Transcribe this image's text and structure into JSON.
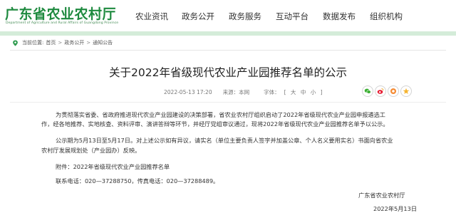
{
  "site": {
    "title": "广东省农业农村厅",
    "subtitle": "Department of Agriculture and Rural Affairs of Guangdong Province"
  },
  "nav": {
    "items": [
      {
        "label": "农业资讯"
      },
      {
        "label": "政务公开"
      },
      {
        "label": "政务服务"
      },
      {
        "label": "互动平台"
      },
      {
        "label": "数据发布"
      },
      {
        "label": "组织机构"
      }
    ]
  },
  "breadcrumb": {
    "prefix": "当前位置:",
    "items": [
      "首页",
      "政务公开",
      "通知公告"
    ],
    "separator": ">"
  },
  "article": {
    "title": "关于2022年省级现代农业产业园推荐名单的公示",
    "datetime": "2022-05-13 17:20",
    "source_label": "来源：本网",
    "fontsize_label": "字体：",
    "fontsize_open": "[",
    "fontsize_options": [
      "大",
      "中",
      "小"
    ],
    "fontsize_close": "]",
    "p1_line1": "为贯彻落实省委、省政府推进现代农业产业园建设的决策部署，省农业农村厅组织启动了2022年省级现代农业产业园申报遴选工",
    "p1_line2": "作，经各地推荐、实地核查、资料评审、演讲答辩等环节，并经厅党组审议通过，现将2022年省级现代农业产业园推荐名单予以公示。",
    "p2_line1": "公示期为5月13日至5月17日。对上述公示如有异议，请实名（单位主要负责人签字并加盖公章、个人名义要用实名）书面向省农业",
    "p2_line2": "农村厅发展规划处（产业园办）反映。",
    "attachment": "附件：2022年省级现代农业产业园推荐名单",
    "contact": "联系电话：020—37288750，传真电话：020—37288489。",
    "signature": "广东省农业农村厅",
    "date": "2022年5月13日"
  },
  "share": {
    "icons": [
      "wechat-icon",
      "weibo-icon",
      "qq-icon",
      "favorite-icon"
    ]
  },
  "colors": {
    "brand_green": "#1e8a3f",
    "nav_bar": "#d4ecd9"
  }
}
